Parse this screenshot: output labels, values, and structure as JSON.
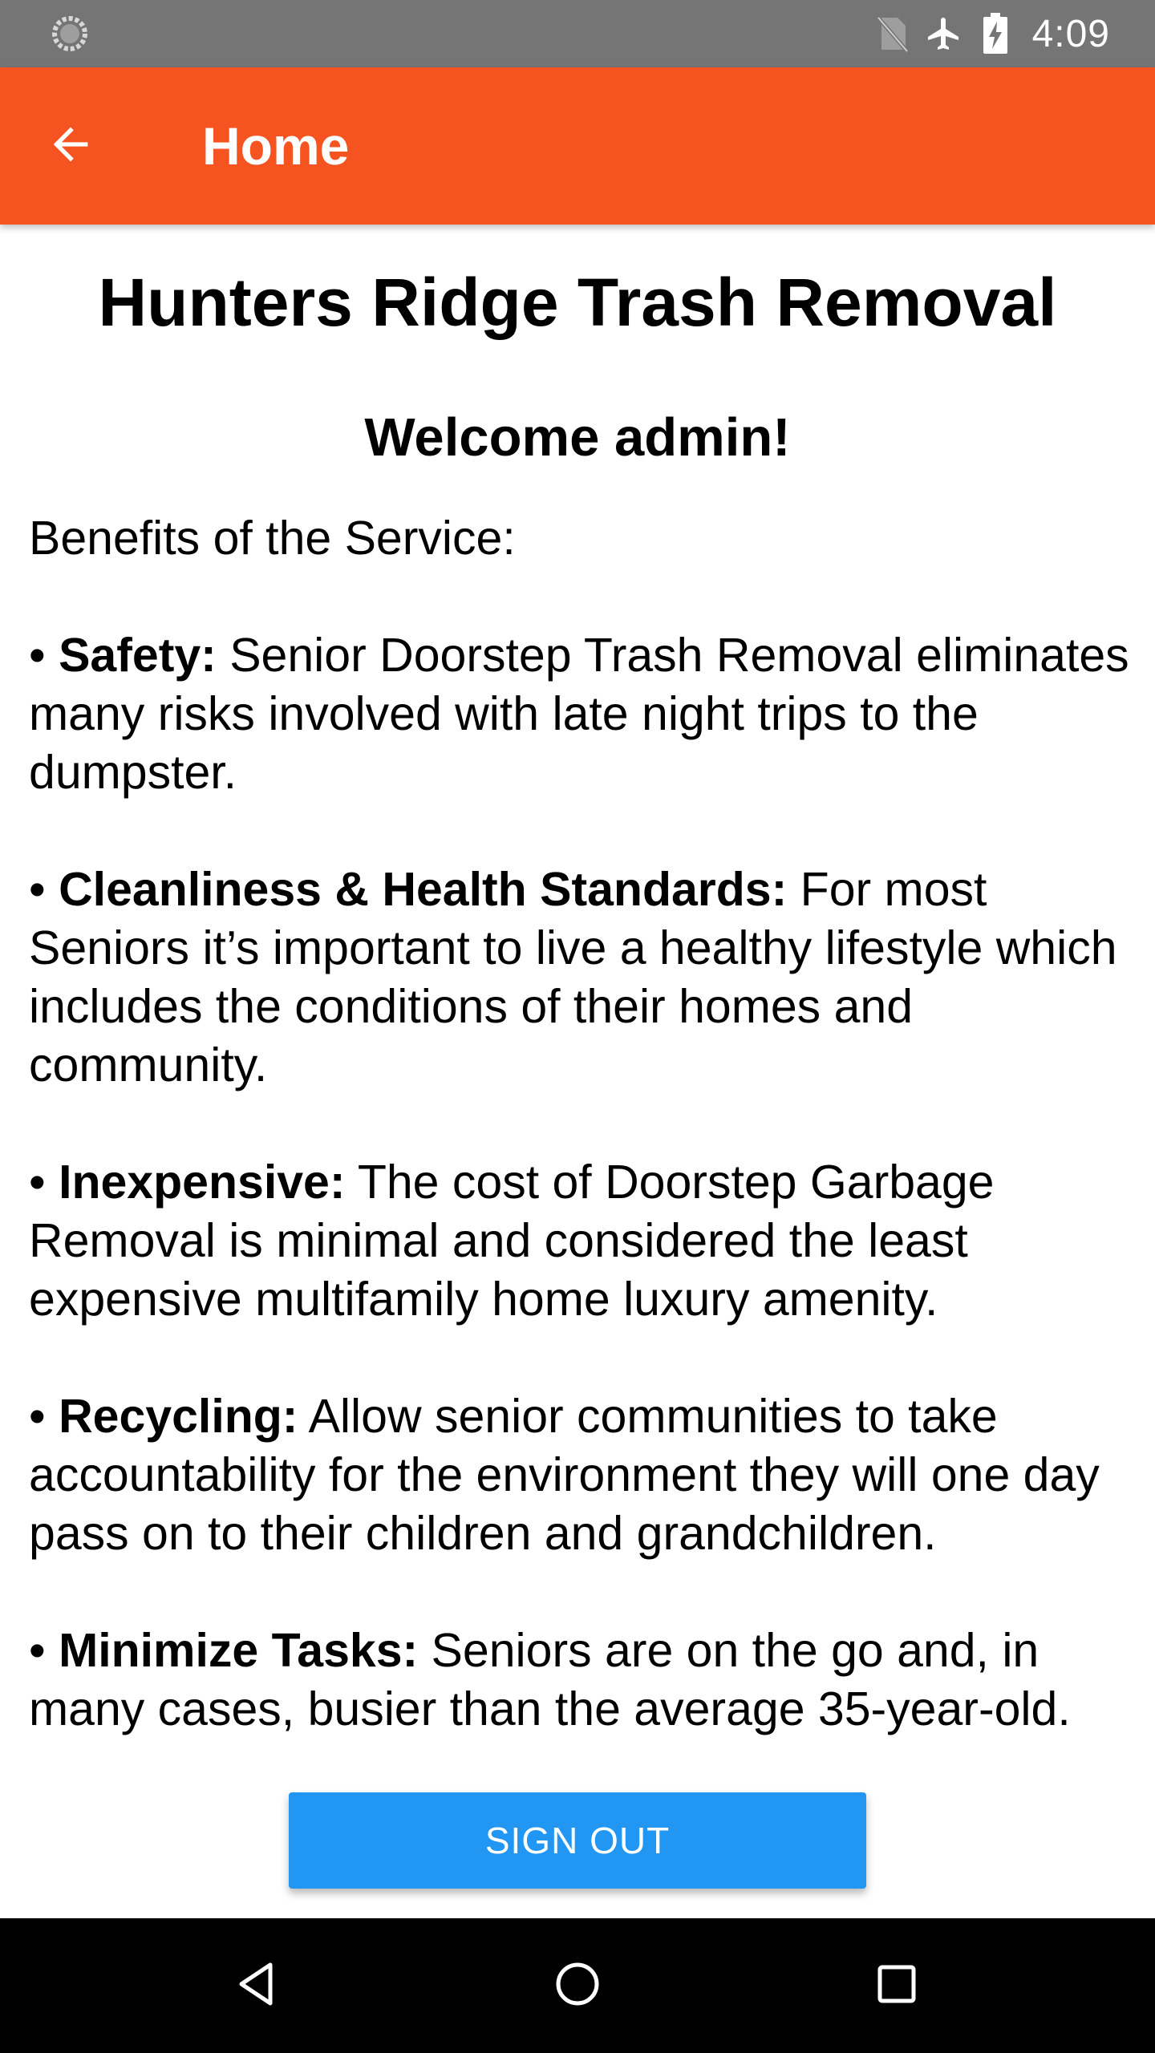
{
  "status_bar": {
    "time": "4:09",
    "icons": [
      "sync-icon",
      "no-sim-icon",
      "airplane-mode-icon",
      "battery-charging-icon"
    ]
  },
  "app_bar": {
    "title": "Home",
    "back_icon": "arrow-back-icon",
    "color": "#F55421"
  },
  "main": {
    "org_title": "Hunters Ridge Trash Removal",
    "welcome": "Welcome admin!",
    "benefits_heading": "Benefits of the Service:",
    "benefits": [
      {
        "bullet": "• ",
        "title": "Safety:",
        "text": " Senior Doorstep Trash Removal eliminates many risks involved with late night trips to the dumpster."
      },
      {
        "bullet": "• ",
        "title": "Cleanliness & Health Standards:",
        "text": " For most Seniors it’s important to live a healthy lifestyle which includes the conditions of their homes and community."
      },
      {
        "bullet": "• ",
        "title": "Inexpensive:",
        "text": " The cost of Doorstep Garbage Removal is minimal and considered the least expensive multifamily home luxury amenity."
      },
      {
        "bullet": "• ",
        "title": "Recycling:",
        "text": " Allow senior communities to take accountability for the environment they will one day pass on to their children and grandchildren."
      },
      {
        "bullet": "• ",
        "title": "Minimize Tasks:",
        "text": " Seniors are on the go and, in many cases, busier than the average 35-year-old."
      }
    ],
    "sign_out_label": "SIGN OUT",
    "button_color": "#2196F3"
  },
  "nav_bar": {
    "items": [
      "back-triangle-icon",
      "home-circle-icon",
      "recents-square-icon"
    ]
  }
}
